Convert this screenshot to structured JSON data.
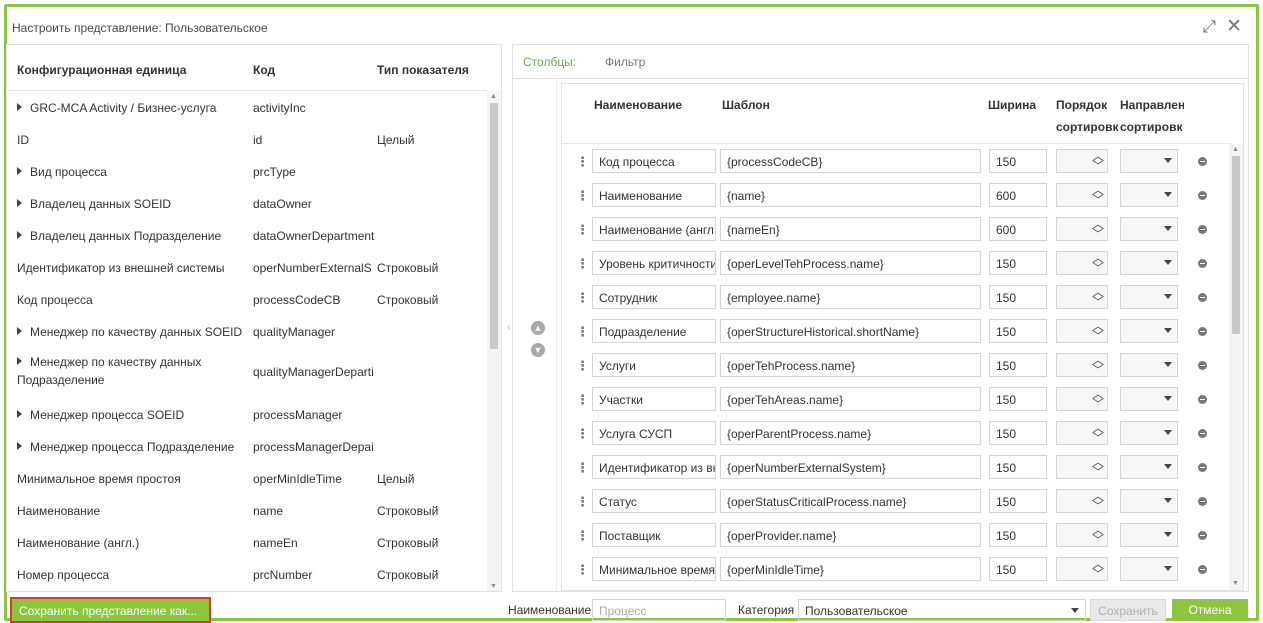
{
  "dialog": {
    "title": "Настроить представление: Пользовательское",
    "expand_glyph": "⤢",
    "close_glyph": "✕"
  },
  "left_panel": {
    "headers": [
      "Конфигурационная единица",
      "Код",
      "Тип показателя"
    ],
    "rows": [
      {
        "name": "GRC-MCA Activity / Бизнес-услуга",
        "code": "activityInc",
        "type": "",
        "expandable": true
      },
      {
        "name": "ID",
        "code": "id",
        "type": "Целый",
        "expandable": false
      },
      {
        "name": "Вид процесса",
        "code": "prcType",
        "type": "",
        "expandable": true
      },
      {
        "name": "Владелец данных SOEID",
        "code": "dataOwner",
        "type": "",
        "expandable": true
      },
      {
        "name": "Владелец данных Подразделение",
        "code": "dataOwnerDepartment",
        "type": "",
        "expandable": true
      },
      {
        "name": "Идентификатор из внешней системы",
        "code": "operNumberExternalS",
        "type": "Строковый",
        "expandable": false
      },
      {
        "name": "Код процесса",
        "code": "processCodeCB",
        "type": "Строковый",
        "expandable": false
      },
      {
        "name": "Менеджер по качеству данных SOEID",
        "code": "qualityManager",
        "type": "",
        "expandable": true
      },
      {
        "name": "Менеджер по качеству данных Подразделение",
        "code": "qualityManagerDeparti",
        "type": "",
        "expandable": true,
        "tall": true
      },
      {
        "name": "Менеджер процесса SOEID",
        "code": "processManager",
        "type": "",
        "expandable": true
      },
      {
        "name": "Менеджер процесса Подразделение",
        "code": "processManagerDepai",
        "type": "",
        "expandable": true
      },
      {
        "name": "Минимальное время простоя",
        "code": "operMinIdleTime",
        "type": "Целый",
        "expandable": false
      },
      {
        "name": "Наименование",
        "code": "name",
        "type": "Строковый",
        "expandable": false
      },
      {
        "name": "Наименование (англ.)",
        "code": "nameEn",
        "type": "Строковый",
        "expandable": false
      },
      {
        "name": "Номер процесса",
        "code": "prcNumber",
        "type": "Строковый",
        "expandable": false
      }
    ]
  },
  "right_panel": {
    "tabs": [
      "Столбцы:",
      "Фильтр"
    ],
    "headers": {
      "name": "Наименование",
      "template": "Шаблон",
      "width": "Ширина",
      "sort_order_1": "Порядок",
      "sort_order_2": "сортировк",
      "sort_dir_1": "Направлен",
      "sort_dir_2": "сортировк"
    },
    "rows": [
      {
        "name": "Код процесса",
        "template": "{processCodeCB}",
        "width": "150"
      },
      {
        "name": "Наименование",
        "template": "{name}",
        "width": "600"
      },
      {
        "name": "Наименование (англ.",
        "template": "{nameEn}",
        "width": "600"
      },
      {
        "name": "Уровень критичности",
        "template": "{operLevelTehProcess.name}",
        "width": "150"
      },
      {
        "name": "Сотрудник",
        "template": "{employee.name}",
        "width": "150"
      },
      {
        "name": "Подразделение",
        "template": "{operStructureHistorical.shortName}",
        "width": "150"
      },
      {
        "name": "Услуги",
        "template": "{operTehProcess.name}",
        "width": "150"
      },
      {
        "name": "Участки",
        "template": "{operTehAreas.name}",
        "width": "150"
      },
      {
        "name": "Услуга СУСП",
        "template": "{operParentProcess.name}",
        "width": "150"
      },
      {
        "name": "Идентификатор из вн",
        "template": "{operNumberExternalSystem}",
        "width": "150"
      },
      {
        "name": "Статус",
        "template": "{operStatusCriticalProcess.name}",
        "width": "150"
      },
      {
        "name": "Поставщик",
        "template": "{operProvider.name}",
        "width": "150"
      },
      {
        "name": "Минимальное время",
        "template": "{operMinIdleTime}",
        "width": "150"
      }
    ]
  },
  "footer": {
    "save_as_label": "Сохранить представление как...",
    "name_label": "Наименование",
    "name_placeholder": "Процесс",
    "category_label": "Категория",
    "category_value": "Пользовательское",
    "save_label": "Сохранить",
    "cancel_label": "Отмена"
  },
  "colors": {
    "accent": "#8cc63f",
    "highlight_border": "#d83b2d",
    "active_tab": "#6aa84f"
  }
}
